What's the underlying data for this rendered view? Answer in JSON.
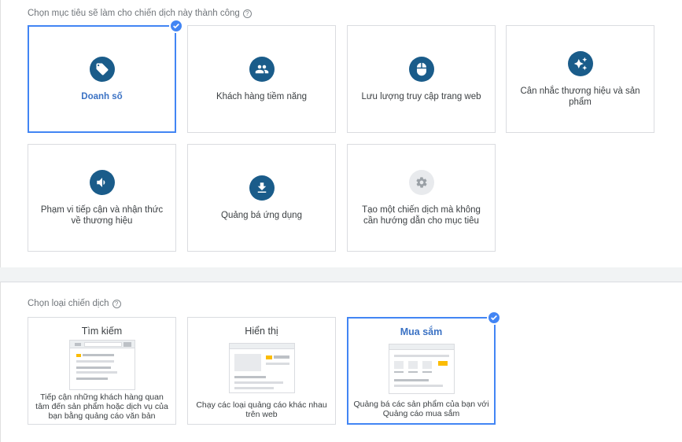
{
  "goals": {
    "heading": "Chọn mục tiêu sẽ làm cho chiến dịch này thành công",
    "help_icon": "question-circle-icon",
    "items": [
      {
        "label": "Doanh số",
        "icon": "tag-icon",
        "selected": true
      },
      {
        "label": "Khách hàng tiềm năng",
        "icon": "people-icon",
        "selected": false
      },
      {
        "label": "Lưu lượng truy cập trang web",
        "icon": "mouse-icon",
        "selected": false
      },
      {
        "label": "Cân nhắc thương hiệu và sản phẩm",
        "icon": "sparkle-icon",
        "selected": false
      },
      {
        "label": "Phạm vi tiếp cận và nhận thức về thương hiệu",
        "icon": "speaker-icon",
        "selected": false
      },
      {
        "label": "Quảng bá ứng dụng",
        "icon": "download-icon",
        "selected": false
      },
      {
        "label": "Tạo một chiến dịch mà không cần hướng dẫn cho mục tiêu",
        "icon": "gear-icon",
        "selected": false
      }
    ]
  },
  "campaign_types": {
    "heading": "Chọn loại chiến dịch",
    "help_icon": "question-circle-icon",
    "items": [
      {
        "title": "Tìm kiếm",
        "description": "Tiếp cận những khách hàng quan tâm đến sản phẩm hoặc dịch vụ của bạn bằng quảng cáo văn bản",
        "selected": false
      },
      {
        "title": "Hiển thị",
        "description": "Chạy các loại quảng cáo khác nhau trên web",
        "selected": false
      },
      {
        "title": "Mua sắm",
        "description": "Quảng bá các sản phẩm của bạn với Quảng cáo mua sắm",
        "selected": true
      }
    ]
  },
  "colors": {
    "accent": "#4285f4",
    "icon_circle": "#1a5c8a",
    "selected_text": "#3b72c4",
    "thumb_yellow": "#fbbc04"
  }
}
